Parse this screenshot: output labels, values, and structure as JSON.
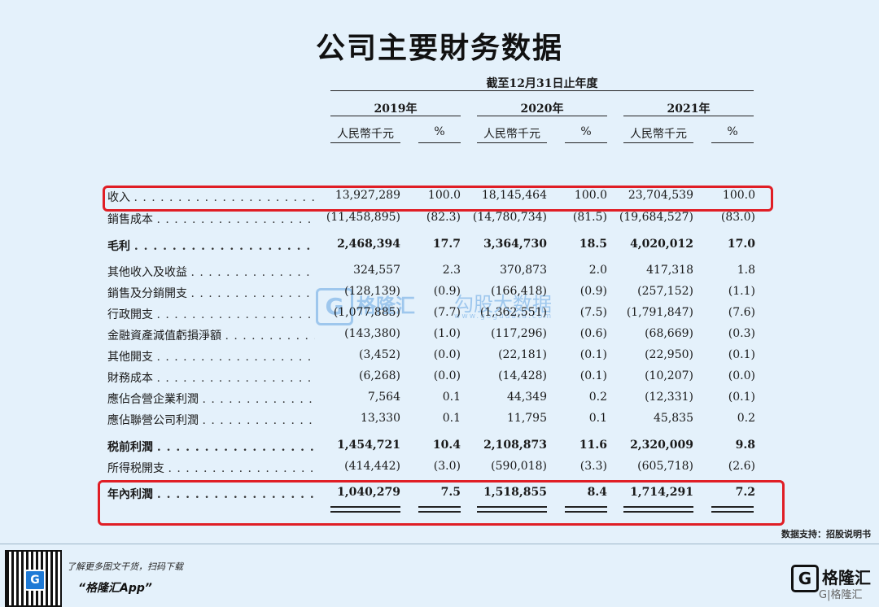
{
  "title": "公司主要財务数据",
  "period_label": "截至12月31日止年度",
  "years": [
    "2019年",
    "2020年",
    "2021年"
  ],
  "unit_rmb": "人民幣千元",
  "unit_pct": "%",
  "rows": [
    {
      "label": "收入",
      "dots": ". . . . . . . . . . . . . . . . . . . . . . . . . .",
      "v": [
        "13,927,289",
        "100.0",
        "18,145,464",
        "100.0",
        "23,704,539",
        "100.0"
      ]
    },
    {
      "label": "銷售成本",
      "dots": ". . . . . . . . . . . . . . . . . . . . . . . .",
      "v": [
        "(11,458,895)",
        "(82.3)",
        "(14,780,734)",
        "(81.5)",
        "(19,684,527)",
        "(83.0)"
      ]
    },
    {
      "label": "毛利",
      "dots": ". . . . . . . . . . . . . . . . . . . . . . . . .",
      "v": [
        "2,468,394",
        "17.7",
        "3,364,730",
        "18.5",
        "4,020,012",
        "17.0"
      ]
    },
    {
      "label": "其他收入及收益",
      "dots": ". . . . . . . . . . . . . . . . . . .",
      "v": [
        "324,557",
        "2.3",
        "370,873",
        "2.0",
        "417,318",
        "1.8"
      ]
    },
    {
      "label": "銷售及分銷開支",
      "dots": ". . . . . . . . . . . . . . . . . . .",
      "v": [
        "(128,139)",
        "(0.9)",
        "(166,418)",
        "(0.9)",
        "(257,152)",
        "(1.1)"
      ]
    },
    {
      "label": "行政開支",
      "dots": ". . . . . . . . . . . . . . . . . . . . . . . .",
      "v": [
        "(1,077,885)",
        "(7.7)",
        "(1,362,551)",
        "(7.5)",
        "(1,791,847)",
        "(7.6)"
      ]
    },
    {
      "label": "金融資產減值虧損淨額",
      "dots": ". . . . . . . . . . . . . .",
      "v": [
        "(143,380)",
        "(1.0)",
        "(117,296)",
        "(0.6)",
        "(68,669)",
        "(0.3)"
      ]
    },
    {
      "label": "其他開支",
      "dots": ". . . . . . . . . . . . . . . . . . . . . . . .",
      "v": [
        "(3,452)",
        "(0.0)",
        "(22,181)",
        "(0.1)",
        "(22,950)",
        "(0.1)"
      ]
    },
    {
      "label": "財務成本",
      "dots": ". . . . . . . . . . . . . . . . . . . . . . . .",
      "v": [
        "(6,268)",
        "(0.0)",
        "(14,428)",
        "(0.1)",
        "(10,207)",
        "(0.0)"
      ]
    },
    {
      "label": "應佔合營企業利潤",
      "dots": ". . . . . . . . . . . . . . . . . .",
      "v": [
        "7,564",
        "0.1",
        "44,349",
        "0.2",
        "(12,331)",
        "(0.1)"
      ]
    },
    {
      "label": "應佔聯營公司利潤",
      "dots": ". . . . . . . . . . . . . . . . . .",
      "v": [
        "13,330",
        "0.1",
        "11,795",
        "0.1",
        "45,835",
        "0.2"
      ]
    },
    {
      "label": "税前利潤",
      "dots": ". . . . . . . . . . . . . . . . . . . . . . .",
      "v": [
        "1,454,721",
        "10.4",
        "2,108,873",
        "11.6",
        "2,320,009",
        "9.8"
      ]
    },
    {
      "label": "所得税開支",
      "dots": ". . . . . . . . . . . . . . . . . . . . . .",
      "v": [
        "(414,442)",
        "(3.0)",
        "(590,018)",
        "(3.3)",
        "(605,718)",
        "(2.6)"
      ]
    },
    {
      "label": "年內利潤",
      "dots": ". . . . . . . . . . . . . . . . . . . . . . .",
      "v": [
        "1,040,279",
        "7.5",
        "1,518,855",
        "8.4",
        "1,714,291",
        "7.2"
      ]
    }
  ],
  "source": "数据支持：招股说明书",
  "watermark": {
    "brand": "格隆汇",
    "name": "勾股大数据",
    "url": "www.gogudata.com"
  },
  "promo": {
    "line1": "了解更多图文干货，扫码下载",
    "line2": "“格隆汇App”"
  },
  "logo": {
    "brand": "格隆汇",
    "mark": "G",
    "sub": "G|格隆汇"
  }
}
